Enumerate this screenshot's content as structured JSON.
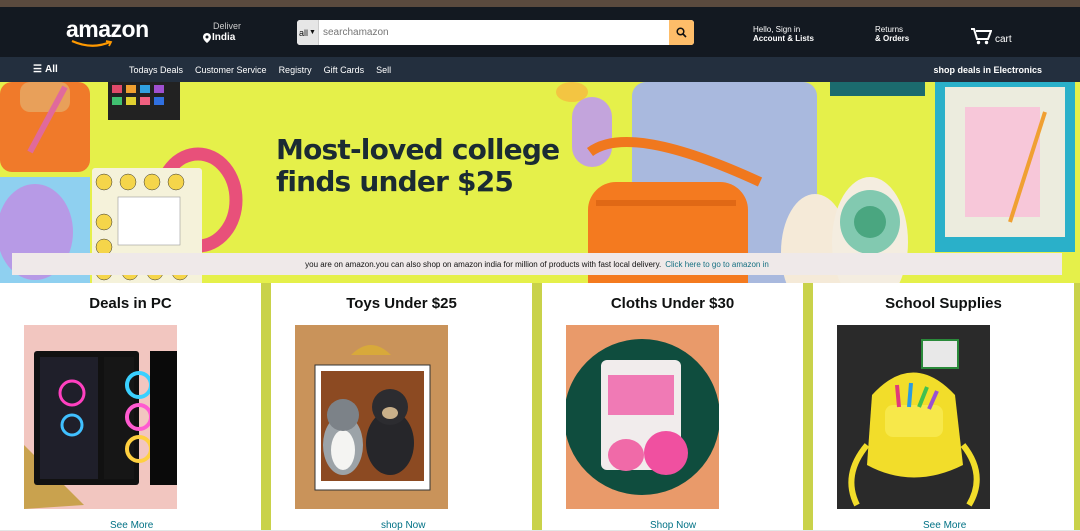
{
  "nav": {
    "logo": "amazon",
    "deliver_label": "Deliver",
    "deliver_location": "India",
    "search_category": "all",
    "search_placeholder": "searchamazon",
    "account_line1": "Hello, Sign in",
    "account_line2": "Account & Lists",
    "returns_line1": "Returns",
    "returns_line2": "& Orders",
    "cart_label": "cart"
  },
  "subnav": {
    "all_label": "All",
    "links": [
      "Todays Deals",
      "Customer Service",
      "Registry",
      "Gift Cards",
      "Sell"
    ],
    "promo": "shop deals in Electronics"
  },
  "hero": {
    "title_line1": "Most-loved college",
    "title_line2": "finds under $25"
  },
  "notice": {
    "text": "you are on amazon.you can also shop on amazon india for million of products with fast local delivery.",
    "link": "Click here to go to amazon in"
  },
  "cards": [
    {
      "title": "Deals in PC",
      "link": "See More"
    },
    {
      "title": "Toys Under $25",
      "link": "shop Now"
    },
    {
      "title": "Cloths Under $30",
      "link": "Shop Now"
    },
    {
      "title": "School Supplies",
      "link": "See More"
    }
  ],
  "colors": {
    "nav_bg": "#131921",
    "subnav_bg": "#232f3e",
    "search_button": "#febd69",
    "hero_bg": "#e5f04a",
    "link": "#007185"
  }
}
